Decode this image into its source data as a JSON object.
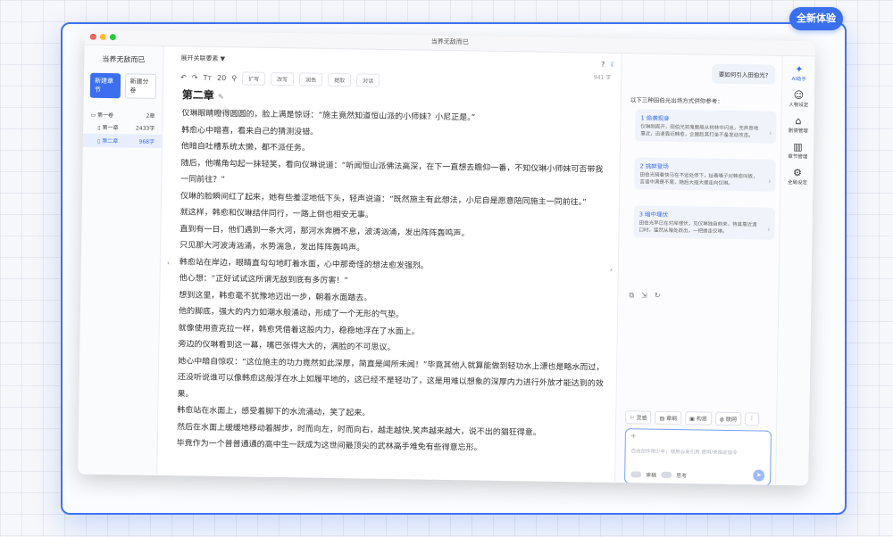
{
  "badge": "全新体验",
  "window_title": "当养无敌而已",
  "left_panel": {
    "book_title": "当养无敌而已",
    "new_chapter": "新建章节",
    "new_volume": "新建分卷",
    "volume": {
      "name": "第一卷",
      "count": "2章"
    },
    "chapters": [
      {
        "name": "第一章",
        "count": "2433字"
      },
      {
        "name": "第二章",
        "count": "968字"
      }
    ]
  },
  "editor": {
    "expand_label": "展开关联要素 ▼",
    "word_count": "941 字",
    "font_size": "20",
    "toolbar": [
      "扩写",
      "改写",
      "润色",
      "提取",
      "对话"
    ],
    "chapter_title": "第二章",
    "paragraphs": [
      "仪琳眼睛瞪得圆圆的，脸上满是惊讶：“施主竟然知道恒山派的小师妹？小尼正是。”",
      "韩愈心中暗喜，看来自己的猜测没错。",
      "他暗自吐槽系统太懒，都不派任务。",
      "随后，他嘴角勾起一抹轻笑，看向仪琳说道：“听闻恒山派佛法高深，在下一直想去瞻仰一番，不知仪琳小师妹可否带我一同前往？”",
      "仪琳的脸瞬间红了起来，她有些羞涩地低下头，轻声说道：“既然施主有此想法，小尼自是愿意陪同施主一同前往。”",
      "就这样，韩愈和仪琳结伴同行，一路上倒也相安无事。",
      "直到有一日，他们遇到一条大河，那河水奔腾不息，波涛汹涌，发出阵阵轰鸣声。",
      "只见那大河波涛汹涌，水势湍急，发出阵阵轰鸣声。",
      "韩愈站在岸边，眼睛直勾勾地盯着水面，心中那奇怪的想法愈发强烈。",
      "他心想：“正好试试这所谓无敌到底有多厉害！”",
      "想到这里，韩愈毫不犹豫地迈出一步，朝着水面踏去。",
      "他的脚底，强大的内力如潮水般涌动，形成了一个无形的气垫。",
      "就像使用查克拉一样，韩愈凭借着这股内力，稳稳地浮在了水面上。",
      "旁边的仪琳看到这一幕，嘴巴张得大大的，满脸的不可思议。",
      "她心中暗自惊叹：“这位施主的功力竟然如此深厚，简直是闻所未闻！”毕竟其他人就算能做到轻功水上漂也是略水而过，还没听说谁可以像韩愈这般浮在水上如履平地的，这已经不是轻功了，这是用难以想象的深厚内力进行外放才能达到的效果。",
      "韩愈站在水面上，感受着脚下的水流涌动，笑了起来。",
      "然后在水面上缓缓地移动着脚步，时而向左，时而向右，越走越快,笑声越来越大，说不出的猖狂得意。",
      "毕竟作为一个普普通通的高中生一跃成为这世间最顶尖的武林高手难免有些得意忘形。"
    ]
  },
  "assistant": {
    "question": "要如何引入田伯光?",
    "intro": "以下三种田伯光出场方式供你参考：",
    "options": [
      {
        "title": "1 偷袭现身",
        "desc": "仪琳刚离开，田伯光如鬼魅般从树林中闪出，无声息地靠近，迅速靠近韩愈，企图趁其打坐不备发动攻击。"
      },
      {
        "title": "2 挑衅登场",
        "desc": "田伯光骑着快马在不远处停下，扯着嗓子对韩愈叫板，言语中满是不屑，随后大摇大摆走向仪琳。"
      },
      {
        "title": "3 暗中埋伏",
        "desc": "田伯光早已在对岸埋伏，见仪琳独自前来，待其靠近渡口时，猛然从暗处跃出，一把掳走仪琳。"
      }
    ],
    "chips": [
      "灵感",
      "章纲",
      "构思",
      "联网"
    ],
    "input_placeholder": "自由创作吧少年，使用@来引用,使用/来指定指令",
    "review_label": "审稿",
    "think_label": "思考"
  },
  "sidebar": {
    "items": [
      {
        "label": "AI助手",
        "icon": "sparkle-icon"
      },
      {
        "label": "人物设定",
        "icon": "people-icon"
      },
      {
        "label": "剧情管理",
        "icon": "bookmark-icon"
      },
      {
        "label": "章节管理",
        "icon": "panel-icon"
      },
      {
        "label": "全局设定",
        "icon": "gear-icon"
      }
    ]
  },
  "colors": {
    "accent": "#3b6ff0",
    "frame": "#3d74f0"
  }
}
